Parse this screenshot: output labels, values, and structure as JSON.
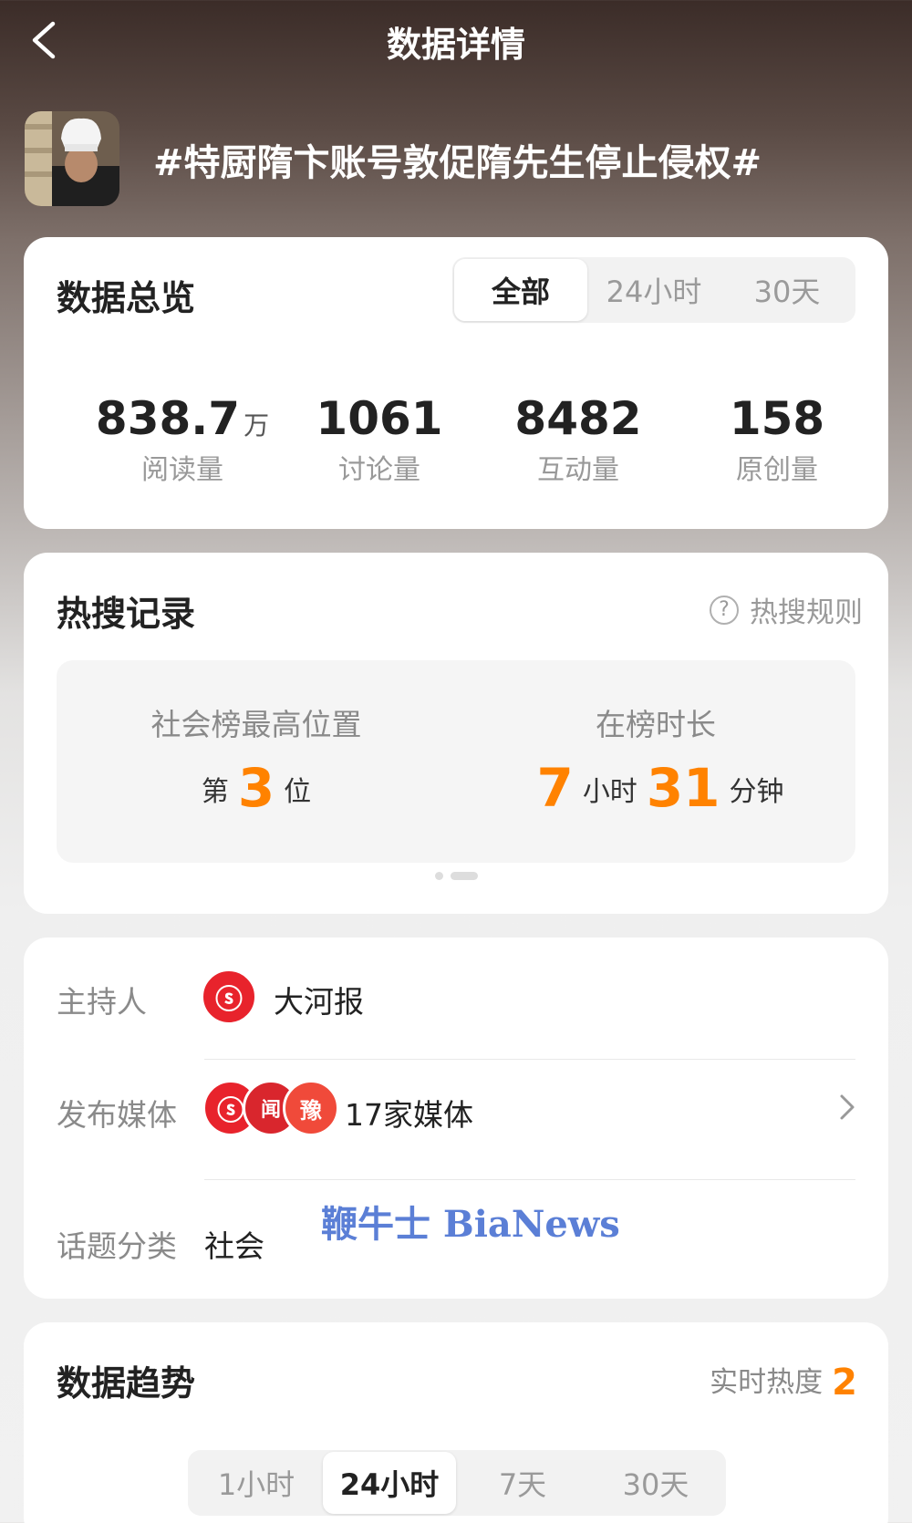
{
  "header": {
    "title": "数据详情",
    "topic": "#特厨隋卞账号敦促隋先生停止侵权#"
  },
  "overview": {
    "title": "数据总览",
    "tabs": [
      "全部",
      "24小时",
      "30天"
    ],
    "active_tab": "全部",
    "stats": [
      {
        "value": "838.7",
        "unit": "万",
        "label": "阅读量"
      },
      {
        "value": "1061",
        "unit": "",
        "label": "讨论量"
      },
      {
        "value": "8482",
        "unit": "",
        "label": "互动量"
      },
      {
        "value": "158",
        "unit": "",
        "label": "原创量"
      }
    ]
  },
  "hot_search": {
    "title": "热搜记录",
    "rule_link": "热搜规则",
    "rank_heading": "社会榜最高位置",
    "rank_prefix": "第",
    "rank_value": "3",
    "rank_suffix": "位",
    "duration_heading": "在榜时长",
    "hours_value": "7",
    "hours_unit": "小时",
    "minutes_value": "31",
    "minutes_unit": "分钟",
    "page_count": 2,
    "active_page": 2
  },
  "info": {
    "host_label": "主持人",
    "host_name": "大河报",
    "media_label": "发布媒体",
    "media_count": "17家媒体",
    "category_label": "话题分类",
    "category": "社会",
    "watermark": "鞭牛士 BiaNews"
  },
  "trend": {
    "title": "数据趋势",
    "heat_label": "实时热度",
    "heat_value": "2",
    "tabs": [
      "1小时",
      "24小时",
      "7天",
      "30天"
    ],
    "active_tab": "24小时"
  },
  "colors": {
    "accent": "#ff8200",
    "host_logo": "#e8232c",
    "watermark": "#5b7fd6"
  }
}
